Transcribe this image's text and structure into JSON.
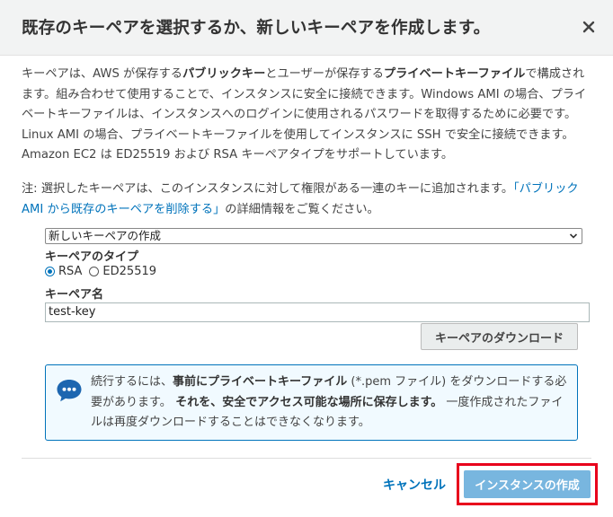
{
  "dialog": {
    "title": "既存のキーペアを選択するか、新しいキーペアを作成します。",
    "close_label": "×"
  },
  "description": {
    "p1_a": "キーペアは、AWS が保存する",
    "p1_b": "パブリックキー",
    "p1_c": "とユーザーが保存する",
    "p1_d": "プライベートキーファイル",
    "p1_e": "で構成されます。組み合わせて使用することで、インスタンスに安全に接続できます。Windows AMI の場合、プライベートキーファイルは、インスタンスへのログインに使用されるパスワードを取得するために必要です。Linux AMI の場合、プライベートキーファイルを使用してインスタンスに SSH で安全に接続できます。Amazon EC2 は ED25519 および RSA キーペアタイプをサポートしています。"
  },
  "note": {
    "prefix": "注: 選択したキーペアは、このインスタンスに対して権限がある一連のキーに追加されます。",
    "link": "「パブリック AMI から既存のキーペアを削除する」",
    "suffix": "の詳細情報をご覧ください。"
  },
  "keypair_select": {
    "selected": "新しいキーペアの作成"
  },
  "keypair_type": {
    "label": "キーペアのタイプ",
    "options": [
      {
        "label": "RSA",
        "selected": true
      },
      {
        "label": "ED25519",
        "selected": false
      }
    ]
  },
  "keypair_name": {
    "label": "キーペア名",
    "value": "test-key"
  },
  "download_button": "キーペアのダウンロード",
  "info_box": {
    "t1": "続行するには、",
    "t2": "事前にプライベートキーファイル",
    "t3": " (*.pem ファイル) をダウンロードする必要があります。",
    "t4": " それを、安全でアクセス可能な場所に保存します。",
    "t5": " 一度作成されたファイルは再度ダウンロードすることはできなくなります。"
  },
  "footer": {
    "cancel": "キャンセル",
    "primary": "インスタンスの作成"
  },
  "colors": {
    "link": "#0073bb",
    "primary_button": "#78b6df",
    "highlight_border": "#e8001c",
    "info_bg": "#f1faff"
  }
}
